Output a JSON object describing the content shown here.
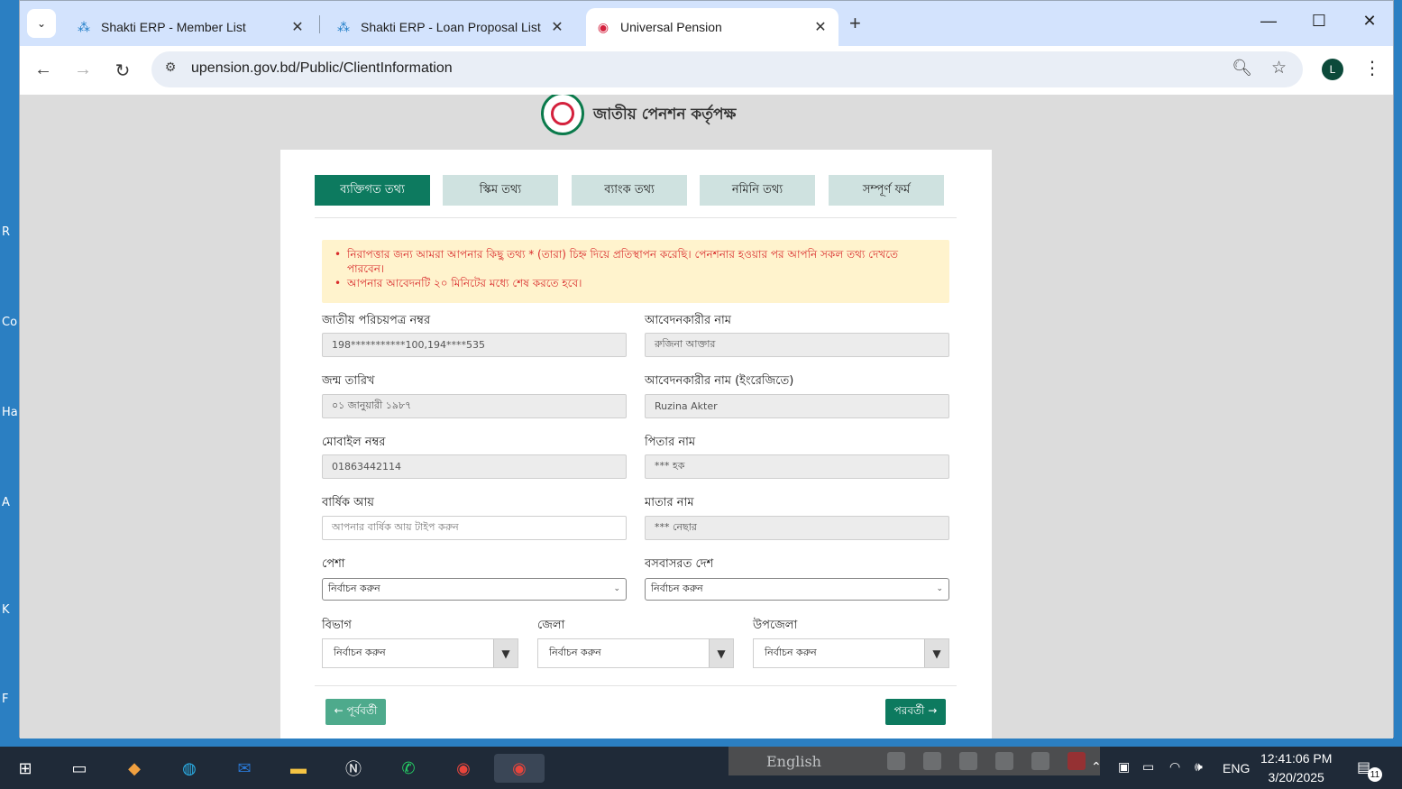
{
  "desktop": {
    "side_letters": [
      "R",
      "Co",
      "Ha",
      "A",
      "K",
      "F"
    ]
  },
  "browser": {
    "tabs": [
      {
        "title": "Shakti ERP - Member List",
        "active": false
      },
      {
        "title": "Shakti ERP - Loan Proposal List",
        "active": false
      },
      {
        "title": "Universal Pension",
        "active": true
      }
    ],
    "new_tab": "+",
    "url": "upension.gov.bd/Public/ClientInformation",
    "profile_initial": "L"
  },
  "page": {
    "brand_text": "জাতীয় পেনশন কর্তৃপক্ষ",
    "steps": [
      "ব্যক্তিগত তথ্য",
      "স্কিম তথ্য",
      "ব্যাংক তথ্য",
      "নমিনি তথ্য",
      "সম্পূর্ণ ফর্ম"
    ],
    "active_step": 0,
    "alerts": [
      "নিরাপত্তার জন্য আমরা আপনার কিছু তথ্য * (তারা) চিহ্ন দিয়ে প্রতিস্থাপন করেছি। পেনশনার হওয়ার পর আপনি সকল তথ্য দেখতে পারবেন।",
      "আপনার আবেদনটি ২০ মিনিটের মধ্যে শেষ করতে হবে।"
    ],
    "fields": {
      "nid_label": "জাতীয় পরিচয়পত্র নম্বর",
      "nid_value": "198***********100,194****535",
      "applicant_name_label": "আবেদনকারীর নাম",
      "applicant_name_value": "রুজিনা আক্তার",
      "dob_label": "জন্ম তারিখ",
      "dob_value": "০১ জানুয়ারী ১৯৮৭",
      "applicant_name_en_label": "আবেদনকারীর নাম (ইংরেজিতে)",
      "applicant_name_en_value": "Ruzina Akter",
      "mobile_label": "মোবাইল নম্বর",
      "mobile_value": "01863442114",
      "father_label": "পিতার নাম",
      "father_value": "*** হক",
      "income_label": "বার্ষিক আয়",
      "income_placeholder": "আপনার বার্ষিক আয় টাইপ করুন",
      "mother_label": "মাতার নাম",
      "mother_value": "*** নেছার",
      "profession_label": "পেশা",
      "profession_value": "নির্বাচন করুন",
      "country_label": "বসবাসরত দেশ",
      "country_value": "নির্বাচন করুন",
      "division_label": "বিভাগ",
      "division_value": "নির্বাচন করুন",
      "district_label": "জেলা",
      "district_value": "নির্বাচন করুন",
      "upazila_label": "উপজেলা",
      "upazila_value": "নির্বাচন করুন"
    },
    "prev_label": "← পূর্ববর্তী",
    "next_label": "পরবর্তী →"
  },
  "taskbar": {
    "language_bar": "English",
    "tray_lang": "ENG",
    "time": "12:41:06 PM",
    "date": "3/20/2025",
    "notification_count": "11"
  }
}
